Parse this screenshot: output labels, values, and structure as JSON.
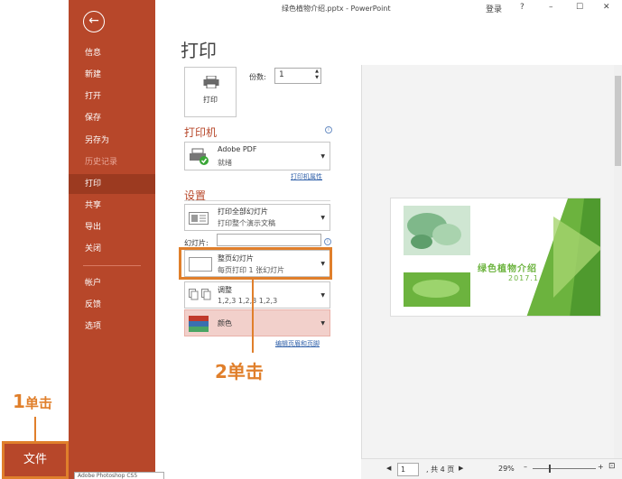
{
  "window": {
    "title": "绿色植物介绍.pptx - PowerPoint",
    "signin": "登录",
    "help": "?",
    "minimize": "–",
    "restore": "☐",
    "close": "✕"
  },
  "nav": {
    "back": "←",
    "items": [
      "信息",
      "新建",
      "打开",
      "保存",
      "另存为",
      "历史记录",
      "打印",
      "共享",
      "导出",
      "关闭",
      "帐户",
      "反馈",
      "选项"
    ],
    "active": "打印"
  },
  "file_button": "文件",
  "tooltip": "Adobe Photoshop CS5",
  "page_title": "打印",
  "print_button": "打印",
  "copies": {
    "label": "份数:",
    "value": "1"
  },
  "printer": {
    "heading": "打印机",
    "name": "Adobe PDF",
    "status": "就绪",
    "properties_link": "打印机属性"
  },
  "settings": {
    "heading": "设置",
    "range": {
      "line1": "打印全部幻灯片",
      "line2": "打印整个演示文稿"
    },
    "slides_label": "幻灯片:",
    "layout": {
      "line1": "整页幻灯片",
      "line2": "每页打印 1 张幻灯片"
    },
    "collate": {
      "line1": "调整",
      "line2": "1,2,3    1,2,3    1,2,3"
    },
    "color": {
      "line1": "颜色"
    },
    "header_footer_link": "编辑页眉和页脚"
  },
  "annotations": {
    "step1": {
      "num": "1",
      "text": "单击"
    },
    "step2": {
      "num": "2",
      "text": "单击"
    }
  },
  "slide_preview": {
    "title": "绿色植物介绍",
    "date": "2017.1.22"
  },
  "status": {
    "page": "1",
    "total": ", 共 4 页",
    "zoom": "29%"
  },
  "colors": {
    "accent": "#b7472a",
    "annotation": "#e07f2b",
    "slide_green": "#6cb33e"
  }
}
